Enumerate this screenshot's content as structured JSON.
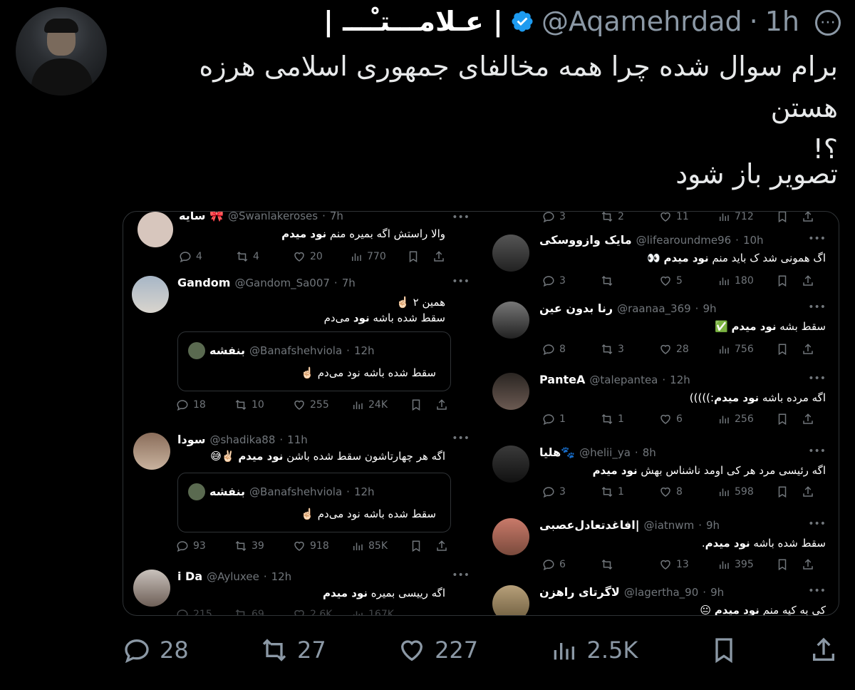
{
  "author": {
    "name": "| عـلامـــتـْـــ |",
    "handle": "@Aqamehrdad",
    "sep": "·",
    "time": "1h"
  },
  "tweet": {
    "text_line1": "برام سوال شده چرا همه مخالفای جمهوری اسلامی هرزه هستن",
    "text_line2": "؟!",
    "show_image": "تصویر باز شود"
  },
  "screenshot": {
    "left": [
      {
        "name": "سایه 🎀",
        "handle": "@Swanlakeroses",
        "time": "7h",
        "text": "والا راستش اگه بمیره منم ",
        "bold": "نود میدم",
        "stats": [
          "4",
          "4",
          "20",
          "770"
        ]
      },
      {
        "name": "Gandom",
        "handle": "@Gandom_Sa007",
        "time": "7h",
        "text1": "همین ۲ ☝🏻",
        "text2": "سقط شده باشه ",
        "bold": "نود",
        "text2b": " می‌دم",
        "quote": {
          "name": "بنفشه",
          "handle": "@Banafshehviola",
          "time": "12h",
          "text": "سقط شده باشه نود می‌دم ☝🏻"
        },
        "stats": [
          "18",
          "10",
          "255",
          "24K"
        ]
      },
      {
        "name": "سودا",
        "handle": "@shadika88",
        "time": "11h",
        "text": "اگه هر چهارتاشون سقط شده باشن ",
        "bold": "نود میدم",
        "emoji": " ✌🏻😅",
        "quote": {
          "name": "بنفشه",
          "handle": "@Banafshehviola",
          "time": "12h",
          "text": "سقط شده باشه نود می‌دم ☝🏻"
        },
        "stats": [
          "93",
          "39",
          "918",
          "85K"
        ]
      },
      {
        "name": "i Da",
        "handle": "@Ayluxee",
        "time": "12h",
        "text": "اگه رییسی بمیره ",
        "bold": "نود میدم",
        "stats": [
          "215",
          "69",
          "2.6K",
          "167K"
        ]
      }
    ],
    "right": [
      {
        "stats_top": [
          "3",
          "2",
          "11",
          "712"
        ]
      },
      {
        "name": "مایک وازووسکی",
        "handle": "@lifearoundme96",
        "time": "10h",
        "text": "اگ همونی شد ک باید منم ",
        "bold": "نود میدم",
        "emoji": " 👀",
        "stats": [
          "3",
          "",
          "5",
          "180"
        ]
      },
      {
        "name": "رنا بدون عین",
        "handle": "@raanaa_369",
        "time": "9h",
        "text": "سقط بشه ",
        "bold": "نود میدم",
        "emoji": " ✅",
        "stats": [
          "8",
          "3",
          "28",
          "756"
        ]
      },
      {
        "name": "PanteA",
        "handle": "@talepantea",
        "time": "12h",
        "text": "اگه مرده باشه ",
        "bold": "نود میدم",
        "emoji": ":)))))",
        "stats": [
          "1",
          "1",
          "6",
          "256"
        ]
      },
      {
        "name": "هلیا🐾",
        "handle": "@helii_ya",
        "time": "8h",
        "text": "اگه رئیسی مرد هر کی اومد ناشناس بهش ",
        "bold": "نود میدم",
        "stats": [
          "3",
          "1",
          "8",
          "598"
        ]
      },
      {
        "name": "افاغدتعادل‌عصبی|",
        "handle": "@iatnwm",
        "time": "9h",
        "text": "سقط شده باشه ",
        "bold": "نود میدم",
        "emoji": ".",
        "stats": [
          "6",
          "",
          "13",
          "395"
        ]
      },
      {
        "name": "لاگرتای راهزن",
        "handle": "@lagertha_90",
        "time": "9h",
        "text": "کی به کیه منم ",
        "bold": "نود میدم",
        "emoji": " 😐"
      }
    ]
  },
  "actions": {
    "replies": "28",
    "retweets": "27",
    "likes": "227",
    "views": "2.5K"
  },
  "colors": {
    "background": "#000000",
    "muted": "#8b98a5",
    "verified": "#1d9bf0",
    "text": "#e7e9ea"
  }
}
